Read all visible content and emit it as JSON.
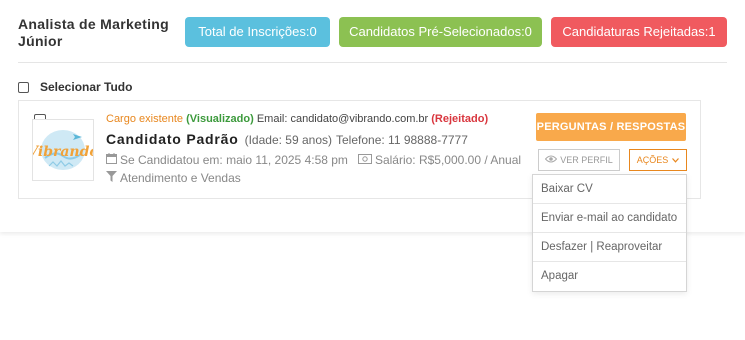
{
  "job": {
    "title": "Analista de Marketing Júnior"
  },
  "stats": {
    "total": "Total de Inscrições:0",
    "preselected": "Candidatos Pré-Selecionados:0",
    "rejected": "Candidaturas Rejeitadas:1",
    "colors": {
      "total": "#5bc0de",
      "preselected": "#8cc152",
      "rejected": "#f05a5f"
    }
  },
  "select_all": {
    "label": "Selecionar Tudo",
    "checked": false
  },
  "candidate": {
    "checked": false,
    "logo_text": "Vibrando",
    "status_prefix": "Cargo existente",
    "viewed_label": "(Visualizado)",
    "email_label": "Email:",
    "email": "candidato@vibrando.com.br",
    "rejected_label": "(Rejeitado)",
    "name": "Candidato Padrão",
    "age": "(Idade: 59 anos)",
    "phone": "Telefone: 11 98888-7777",
    "applied": "Se Candidatou em: maio 11, 2025 4:58 pm",
    "salary": "Salário: R$5,000.00 / Anual",
    "category": "Atendimento e Vendas",
    "icons": {
      "applied": "calendar-icon",
      "salary": "money-icon",
      "category": "filter-icon"
    }
  },
  "actions": {
    "qa_label": "PERGUNTAS / RESPOSTAS",
    "view_profile_label": "VER PERFIL",
    "actions_label": "AÇÕES",
    "menu": [
      "Baixar CV",
      "Enviar e-mail ao candidato",
      "Desfazer | Reaproveitar",
      "Apagar"
    ]
  },
  "colors": {
    "accent_orange": "#e8871e",
    "qa_button": "#f9a94b",
    "reject_red": "#d9363e"
  }
}
